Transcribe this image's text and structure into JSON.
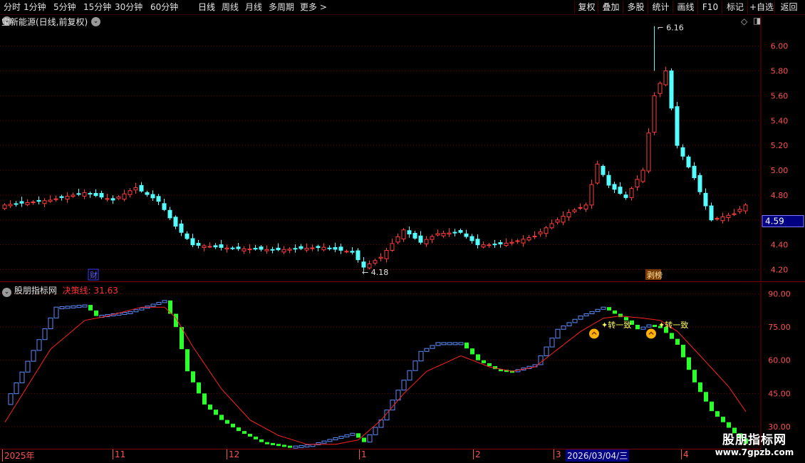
{
  "toolbar": {
    "periods": [
      "分时",
      "1分钟",
      "5分钟",
      "15分钟",
      "30分钟",
      "60分钟",
      "日线",
      "周线",
      "月线",
      "多周期",
      "更多 >"
    ],
    "active_period": "日线",
    "right_buttons": [
      "复权",
      "叠加",
      "多股",
      "统计",
      "画线",
      "F10",
      "标记",
      "+自选",
      "返回"
    ]
  },
  "price_pane": {
    "title": "宝新能源(日线,前复权)",
    "y_ticks": [
      "6.00",
      "5.80",
      "5.60",
      "5.40",
      "5.20",
      "5.00",
      "4.80",
      "4.60",
      "4.40",
      "4.20"
    ],
    "y_range": [
      4.1,
      6.25
    ],
    "current_price": "4.59",
    "high_label": "6.16",
    "low_label": "4.18",
    "markers": [
      "财",
      "剥榜"
    ]
  },
  "indicator_pane": {
    "title": "股朋指标网",
    "line_label": "决策线:",
    "line_value": "31.63",
    "y_ticks": [
      "90.00",
      "75.00",
      "60.00",
      "45.00",
      "30.00"
    ],
    "y_range": [
      20,
      95
    ],
    "annotations": [
      "转一致",
      "转一致"
    ]
  },
  "date_axis": {
    "labels": [
      "2025年",
      "11",
      "12",
      "1",
      "2",
      "3",
      "2026/03/04/三",
      "4"
    ]
  },
  "watermark": {
    "title": "股朋指标网",
    "url": "www.7gpzb.com"
  },
  "colors": {
    "up": "#ff3c3c",
    "down": "#54ffff",
    "grid": "#7a0000",
    "ind_up": "#5a8cff",
    "ind_down": "#2bff2b",
    "decision_line": "#ff2020",
    "axis_text": "#ff5050"
  },
  "chart_data": {
    "type": "candlestick",
    "close_waypoints": [
      [
        0,
        4.72
      ],
      [
        8,
        4.76
      ],
      [
        14,
        4.82
      ],
      [
        19,
        4.76
      ],
      [
        23,
        4.86
      ],
      [
        27,
        4.75
      ],
      [
        30,
        4.55
      ],
      [
        33,
        4.4
      ],
      [
        40,
        4.37
      ],
      [
        48,
        4.36
      ],
      [
        56,
        4.38
      ],
      [
        61,
        4.34
      ],
      [
        63,
        4.22
      ],
      [
        66,
        4.3
      ],
      [
        70,
        4.52
      ],
      [
        73,
        4.42
      ],
      [
        76,
        4.49
      ],
      [
        80,
        4.5
      ],
      [
        83,
        4.4
      ],
      [
        86,
        4.4
      ],
      [
        89,
        4.42
      ],
      [
        93,
        4.47
      ],
      [
        96,
        4.57
      ],
      [
        99,
        4.66
      ],
      [
        102,
        4.72
      ],
      [
        104,
        5.05
      ],
      [
        106,
        4.88
      ],
      [
        109,
        4.78
      ],
      [
        112,
        5.0
      ],
      [
        114,
        5.6
      ],
      [
        116,
        5.8
      ],
      [
        118,
        5.2
      ],
      [
        121,
        4.94
      ],
      [
        124,
        4.6
      ],
      [
        128,
        4.65
      ],
      [
        130,
        4.72
      ]
    ],
    "indicator": {
      "series": [
        "K",
        "决策线"
      ],
      "k_waypoints": [
        [
          0,
          40
        ],
        [
          9,
          84
        ],
        [
          14,
          85
        ],
        [
          16,
          80
        ],
        [
          22,
          82
        ],
        [
          28,
          87
        ],
        [
          30,
          75
        ],
        [
          32,
          55
        ],
        [
          35,
          40
        ],
        [
          38,
          33
        ],
        [
          41,
          28
        ],
        [
          45,
          23
        ],
        [
          50,
          21
        ],
        [
          54,
          22
        ],
        [
          58,
          25
        ],
        [
          61,
          27
        ],
        [
          63,
          23
        ],
        [
          66,
          33
        ],
        [
          70,
          51
        ],
        [
          73,
          64
        ],
        [
          76,
          68
        ],
        [
          80,
          68
        ],
        [
          83,
          60
        ],
        [
          86,
          56
        ],
        [
          89,
          55
        ],
        [
          93,
          58
        ],
        [
          97,
          74
        ],
        [
          101,
          80
        ],
        [
          105,
          84
        ],
        [
          107,
          81
        ],
        [
          109,
          78
        ],
        [
          111,
          74
        ],
        [
          113,
          76
        ],
        [
          115,
          75
        ],
        [
          118,
          67
        ],
        [
          121,
          50
        ],
        [
          124,
          37
        ],
        [
          128,
          27
        ],
        [
          131,
          20
        ]
      ],
      "d_waypoints": [
        [
          0,
          32
        ],
        [
          8,
          65
        ],
        [
          14,
          78
        ],
        [
          18,
          80
        ],
        [
          24,
          84
        ],
        [
          28,
          84
        ],
        [
          30,
          79
        ],
        [
          33,
          66
        ],
        [
          38,
          47
        ],
        [
          43,
          33
        ],
        [
          48,
          26
        ],
        [
          53,
          22
        ],
        [
          58,
          22
        ],
        [
          62,
          24
        ],
        [
          66,
          33
        ],
        [
          70,
          45
        ],
        [
          74,
          55
        ],
        [
          80,
          62
        ],
        [
          85,
          57
        ],
        [
          89,
          55
        ],
        [
          93,
          57
        ],
        [
          97,
          65
        ],
        [
          101,
          73
        ],
        [
          105,
          79
        ],
        [
          108,
          80
        ],
        [
          112,
          79
        ],
        [
          115,
          78
        ],
        [
          118,
          73
        ],
        [
          122,
          62
        ],
        [
          127,
          48
        ],
        [
          131,
          33
        ]
      ]
    }
  }
}
